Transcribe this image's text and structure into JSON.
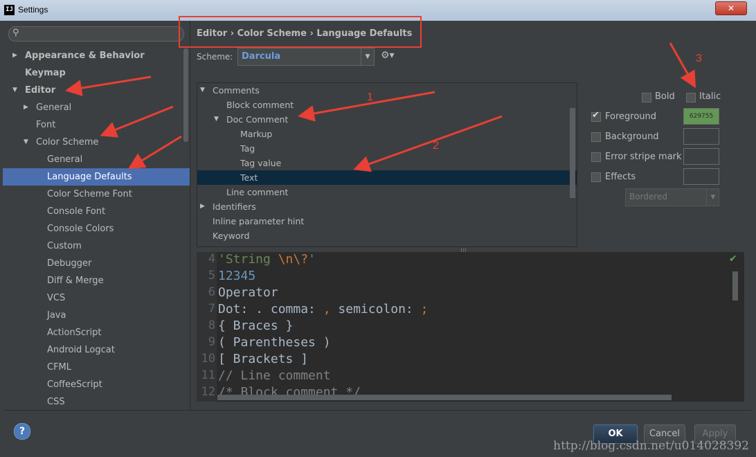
{
  "window": {
    "title": "Settings",
    "logo": "IJ",
    "close_label": "✕"
  },
  "sidebar": {
    "search_placeholder": "",
    "items": [
      {
        "label": "Appearance & Behavior",
        "bold": true,
        "arrow": "▶"
      },
      {
        "label": "Keymap",
        "bold": true
      },
      {
        "label": "Editor",
        "bold": true,
        "arrow": "▼"
      },
      {
        "label": "General",
        "arrow": "▶"
      },
      {
        "label": "Font"
      },
      {
        "label": "Color Scheme",
        "arrow": "▼"
      },
      {
        "label": "General"
      },
      {
        "label": "Language Defaults",
        "selected": true
      },
      {
        "label": "Color Scheme Font"
      },
      {
        "label": "Console Font"
      },
      {
        "label": "Console Colors"
      },
      {
        "label": "Custom"
      },
      {
        "label": "Debugger"
      },
      {
        "label": "Diff & Merge"
      },
      {
        "label": "VCS"
      },
      {
        "label": "Java"
      },
      {
        "label": "ActionScript"
      },
      {
        "label": "Android Logcat"
      },
      {
        "label": "CFML"
      },
      {
        "label": "CoffeeScript"
      },
      {
        "label": "CSS"
      }
    ]
  },
  "breadcrumb": {
    "part1": "Editor",
    "part2": "Color Scheme",
    "part3": "Language Defaults",
    "sep": "›"
  },
  "scheme": {
    "label": "Scheme:",
    "value": "Darcula",
    "gear": "⚙▾"
  },
  "tree": {
    "rows": [
      {
        "label": "Comments",
        "arrow": "▼",
        "level": 0
      },
      {
        "label": "Block comment",
        "level": 1
      },
      {
        "label": "Doc Comment",
        "arrow": "▼",
        "level": 1
      },
      {
        "label": "Markup",
        "level": 2
      },
      {
        "label": "Tag",
        "level": 2
      },
      {
        "label": "Tag value",
        "level": 2
      },
      {
        "label": "Text",
        "level": 2,
        "selected": true
      },
      {
        "label": "Line comment",
        "level": 1
      },
      {
        "label": "Identifiers",
        "arrow": "▶",
        "level": 0
      },
      {
        "label": "Inline parameter hint",
        "level": 0
      },
      {
        "label": "Keyword",
        "level": 0
      }
    ]
  },
  "attributes": {
    "bold_label": "Bold",
    "italic_label": "Italic",
    "foreground_label": "Foreground",
    "foreground_checked": true,
    "foreground_value": "629755",
    "foreground_color": "#629755",
    "background_label": "Background",
    "error_stripe_label": "Error stripe mark",
    "effects_label": "Effects",
    "effects_type": "Bordered"
  },
  "editor": {
    "lines": [
      {
        "num": "4",
        "segments": [
          {
            "t": "'String ",
            "c": "#6a8759"
          },
          {
            "t": "\\n\\?",
            "c": "#cc7832"
          },
          {
            "t": "'",
            "c": "#6a8759"
          }
        ]
      },
      {
        "num": "5",
        "segments": [
          {
            "t": "12345",
            "c": "#6897bb"
          }
        ]
      },
      {
        "num": "6",
        "segments": [
          {
            "t": "Operator",
            "c": "#a9b7c6"
          }
        ]
      },
      {
        "num": "7",
        "segments": [
          {
            "t": "Dot: . comma: ",
            "c": "#a9b7c6"
          },
          {
            "t": ",",
            "c": "#cc7832"
          },
          {
            "t": " semicolon: ",
            "c": "#a9b7c6"
          },
          {
            "t": ";",
            "c": "#cc7832"
          }
        ]
      },
      {
        "num": "8",
        "segments": [
          {
            "t": "{ Braces }",
            "c": "#a9b7c6"
          }
        ]
      },
      {
        "num": "9",
        "segments": [
          {
            "t": "( Parentheses )",
            "c": "#a9b7c6"
          }
        ]
      },
      {
        "num": "10",
        "segments": [
          {
            "t": "[ Brackets ]",
            "c": "#a9b7c6"
          }
        ]
      },
      {
        "num": "11",
        "segments": [
          {
            "t": "// Line comment",
            "c": "#808080"
          }
        ]
      },
      {
        "num": "12",
        "segments": [
          {
            "t": "/* Block comment */",
            "c": "#808080"
          }
        ]
      }
    ]
  },
  "buttons": {
    "help": "?",
    "ok": "OK",
    "cancel": "Cancel",
    "apply": "Apply"
  },
  "watermark": "http://blog.csdn.net/u014028392",
  "annotations": {
    "n1": "1",
    "n2": "2",
    "n3": "3",
    "color": "#e84034"
  }
}
